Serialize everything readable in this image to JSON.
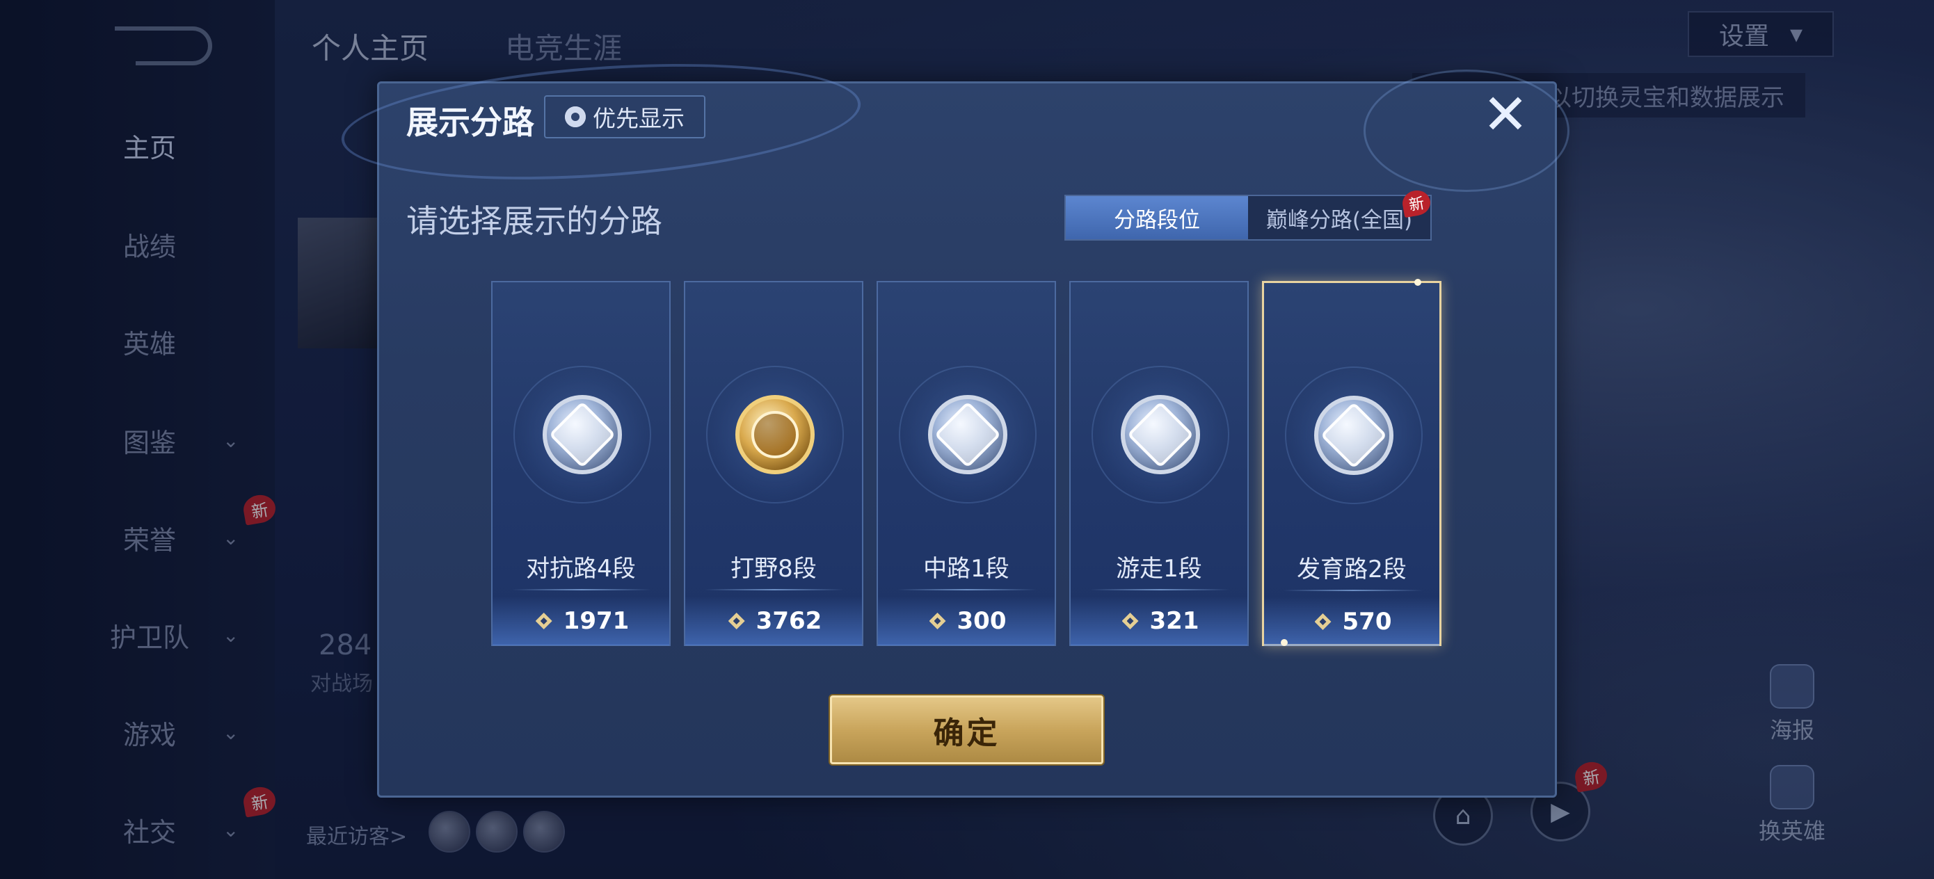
{
  "sidebar": {
    "items": [
      {
        "label": "主页",
        "active": true
      },
      {
        "label": "战绩"
      },
      {
        "label": "英雄"
      },
      {
        "label": "图鉴",
        "expandable": true
      },
      {
        "label": "荣誉",
        "expandable": true,
        "badge": "新"
      },
      {
        "label": "护卫队",
        "expandable": true
      },
      {
        "label": "游戏",
        "expandable": true
      },
      {
        "label": "社交",
        "expandable": true,
        "badge": "新"
      }
    ]
  },
  "header": {
    "tabs": [
      "个人主页",
      "电竞生涯"
    ],
    "settings_label": "设置",
    "hint_text": "以切换灵宝和数据展示"
  },
  "profile_bg": {
    "stat_partial": "284",
    "stat_label_partial": "对战场",
    "visitors_label": "最近访客>"
  },
  "right_tools": {
    "poster_label": "海报",
    "swap_hero_label": "换英雄",
    "new_badge": "新"
  },
  "modal": {
    "title": "展示分路",
    "priority_label": "优先显示",
    "close_icon": "close-icon",
    "subtitle": "请选择展示的分路",
    "toggle": {
      "options": [
        "分路段位",
        "巅峰分路(全国)"
      ],
      "selected": 0,
      "new_badge": "新"
    },
    "lanes": [
      {
        "name": "对抗路4段",
        "score": "1971",
        "emblem": "clash-lane-icon",
        "selected": false
      },
      {
        "name": "打野8段",
        "score": "3762",
        "emblem": "jungle-dragon-icon",
        "selected": false
      },
      {
        "name": "中路1段",
        "score": "300",
        "emblem": "mid-lane-icon",
        "selected": false
      },
      {
        "name": "游走1段",
        "score": "321",
        "emblem": "roam-wings-icon",
        "selected": false
      },
      {
        "name": "发育路2段",
        "score": "570",
        "emblem": "farm-lane-icon",
        "selected": true
      }
    ],
    "confirm_label": "确定"
  },
  "colors": {
    "accent_gold": "#e8d3a0",
    "toggle_on": "#4f78c2",
    "badge_red": "#b9222b"
  }
}
